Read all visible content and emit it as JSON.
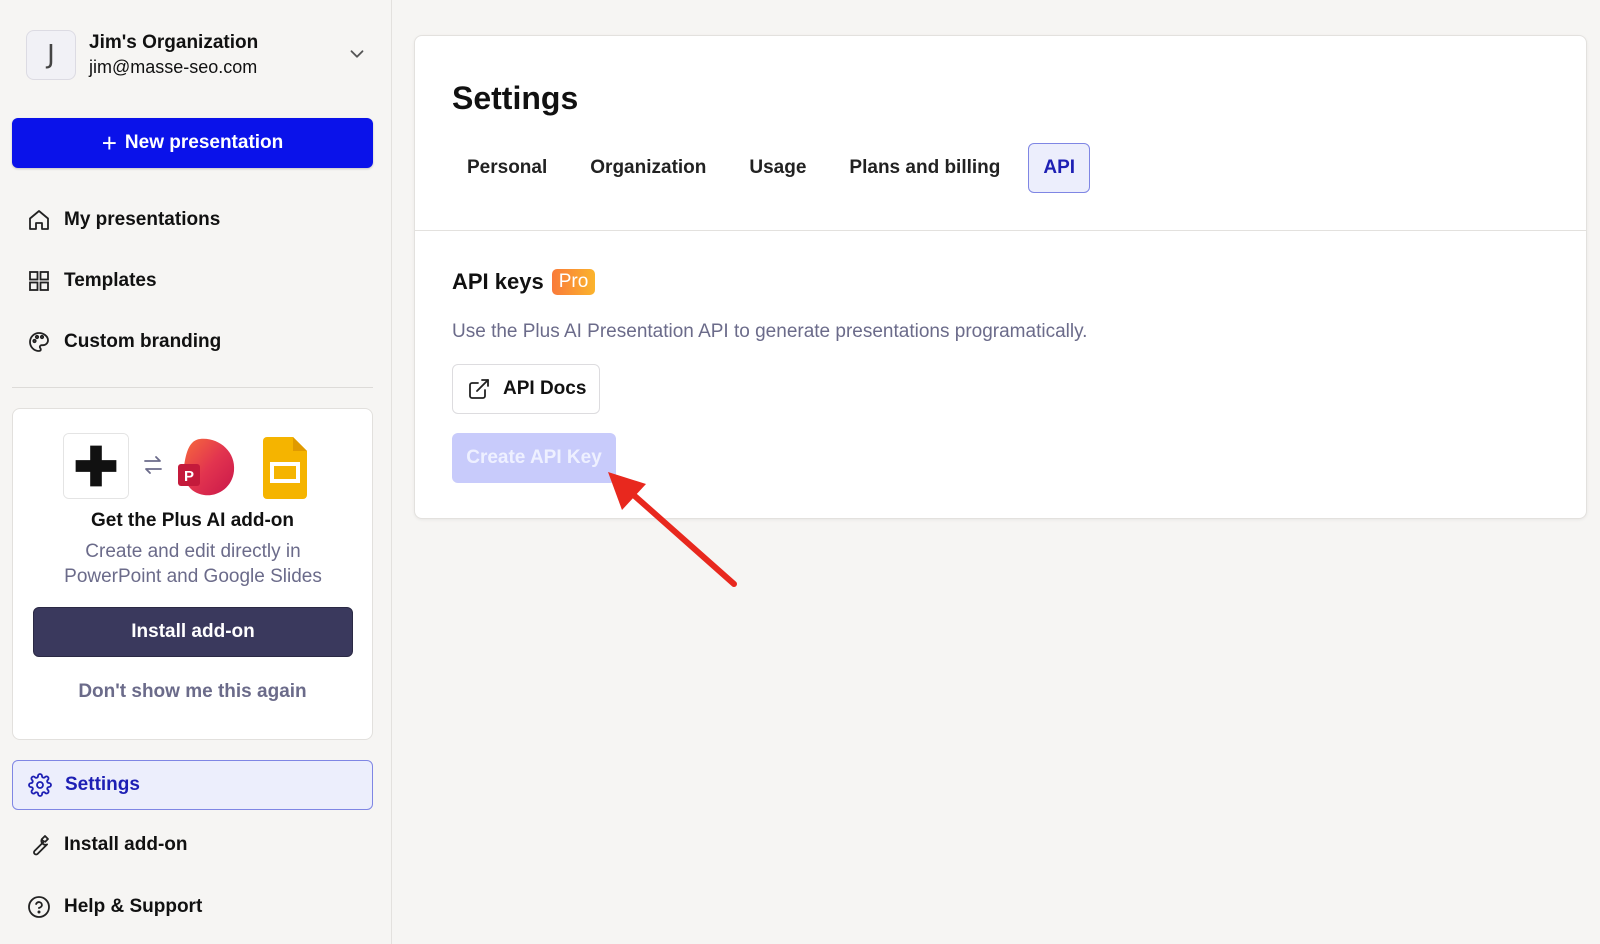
{
  "org": {
    "avatar_letter": "J",
    "name": "Jim's Organization",
    "email": "jim@masse-seo.com"
  },
  "sidebar": {
    "new_presentation": "New presentation",
    "items": [
      {
        "label": "My presentations",
        "icon": "home-icon"
      },
      {
        "label": "Templates",
        "icon": "grid-icon"
      },
      {
        "label": "Custom branding",
        "icon": "palette-icon"
      }
    ],
    "bottom_items": [
      {
        "label": "Settings",
        "icon": "gear-icon",
        "active": true
      },
      {
        "label": "Install add-on",
        "icon": "wrench-icon"
      },
      {
        "label": "Help & Support",
        "icon": "help-circle-icon"
      }
    ]
  },
  "addon_card": {
    "title": "Get the Plus AI add-on",
    "description": "Create and edit directly in PowerPoint and Google Slides",
    "install_label": "Install add-on",
    "dismiss_label": "Don't show me this again",
    "ppt_letter": "P"
  },
  "settings": {
    "title": "Settings",
    "tabs": [
      {
        "label": "Personal"
      },
      {
        "label": "Organization"
      },
      {
        "label": "Usage"
      },
      {
        "label": "Plans and billing"
      },
      {
        "label": "API",
        "active": true
      }
    ],
    "api": {
      "section_title": "API keys",
      "badge": "Pro",
      "description": "Use the Plus AI Presentation API to generate presentations programatically.",
      "docs_label": "API Docs",
      "create_label": "Create API Key"
    }
  },
  "colors": {
    "accent": "#0a12ea",
    "active_bg": "#eceefc",
    "active_text": "#1d1fb4",
    "arrow": "#e8281e",
    "pro_badge": "#f97a3a"
  }
}
